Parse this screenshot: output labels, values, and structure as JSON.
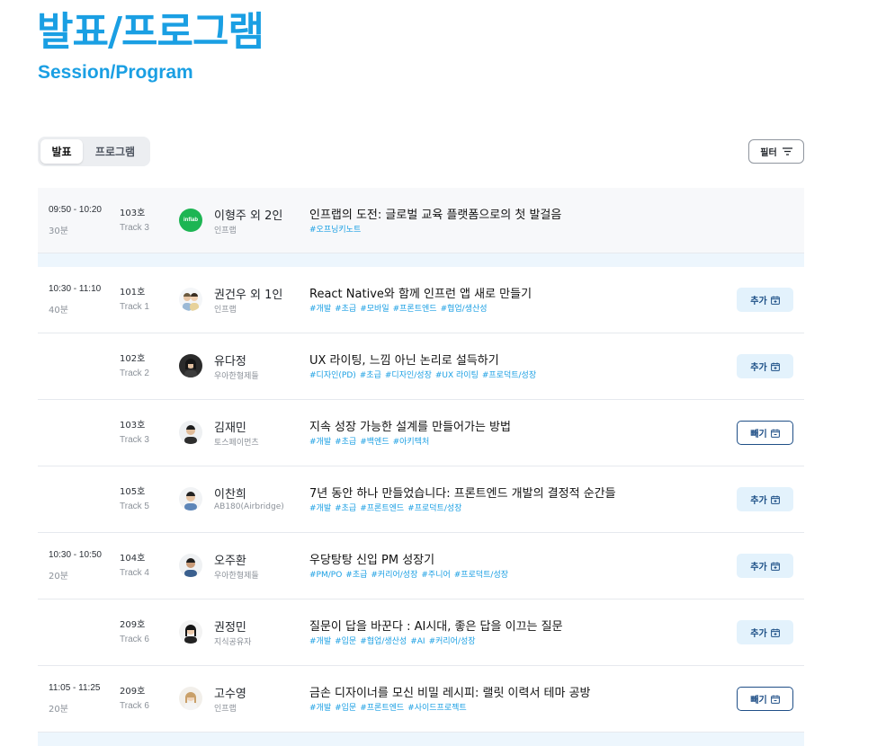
{
  "header": {
    "title_ko": "발표/프로그램",
    "title_en": "Session/Program"
  },
  "tabs": [
    {
      "label": "발표",
      "active": true
    },
    {
      "label": "프로그램",
      "active": false
    }
  ],
  "filter": {
    "label": "필터"
  },
  "colors": {
    "brand": "#1a9fe3",
    "tag": "#1a9fe3",
    "button_dark": "#1f4f87",
    "add_bg": "#e3f2fc"
  },
  "sessions": [
    {
      "time": "09:50 - 10:20",
      "duration": "30분",
      "room": "103호",
      "track": "Track 3",
      "speaker": "이형주 외 2인",
      "org": "인프랩",
      "title": "인프랩의 도전: 글로벌 교육 플랫폼으로의 첫 발걸음",
      "tags": [
        "#오프닝키노트"
      ],
      "action": "",
      "logo_text": "inflab"
    },
    {
      "time": "10:30 - 11:10",
      "duration": "40분",
      "room": "101호",
      "track": "Track 1",
      "speaker": "권건우 외 1인",
      "org": "인프랩",
      "title": "React Native와 함께 인프런 앱 새로 만들기",
      "tags": [
        "#개발",
        "#초급",
        "#모바일",
        "#프론트엔드",
        "#협업/생산성"
      ],
      "action": "추가"
    },
    {
      "time": "",
      "duration": "",
      "room": "102호",
      "track": "Track 2",
      "speaker": "유다정",
      "org": "우아한형제들",
      "title": "UX 라이팅, 느낌 아닌 논리로 설득하기",
      "tags": [
        "#디자인(PD)",
        "#초급",
        "#디자인/성장",
        "#UX 라이팅",
        "#프로덕트/성장"
      ],
      "action": "추가"
    },
    {
      "time": "",
      "duration": "",
      "room": "103호",
      "track": "Track 3",
      "speaker": "김재민",
      "org": "토스페이먼츠",
      "title": "지속 성장 가능한 설계를 만들어가는 방법",
      "tags": [
        "#개발",
        "#초급",
        "#백엔드",
        "#아키텍처"
      ],
      "action": "빼기"
    },
    {
      "time": "",
      "duration": "",
      "room": "105호",
      "track": "Track 5",
      "speaker": "이찬희",
      "org": "AB180(Airbridge)",
      "title": "7년 동안 하나 만들었습니다: 프론트엔드 개발의 결정적 순간들",
      "tags": [
        "#개발",
        "#초급",
        "#프론트엔드",
        "#프로덕트/성장"
      ],
      "action": "추가"
    },
    {
      "time": "10:30 - 10:50",
      "duration": "20분",
      "room": "104호",
      "track": "Track 4",
      "speaker": "오주환",
      "org": "우아한형제들",
      "title": "우당탕탕 신입 PM 성장기",
      "tags": [
        "#PM/PO",
        "#초급",
        "#커리어/성장",
        "#주니어",
        "#프로덕트/성장"
      ],
      "action": "추가"
    },
    {
      "time": "",
      "duration": "",
      "room": "209호",
      "track": "Track 6",
      "speaker": "권정민",
      "org": "지식공유자",
      "title": "질문이 답을 바꾼다 : AI시대, 좋은 답을 이끄는 질문",
      "tags": [
        "#개발",
        "#입문",
        "#협업/생산성",
        "#AI",
        "#커리어/성장"
      ],
      "action": "추가"
    },
    {
      "time": "11:05 - 11:25",
      "duration": "20분",
      "room": "209호",
      "track": "Track 6",
      "speaker": "고수영",
      "org": "인프랩",
      "title": "금손 디자이너를 모신 비밀 레시피: 랠릿 이력서 테마 공방",
      "tags": [
        "#개발",
        "#입문",
        "#프론트엔드",
        "#사이드프로젝트"
      ],
      "action": "빼기"
    }
  ]
}
